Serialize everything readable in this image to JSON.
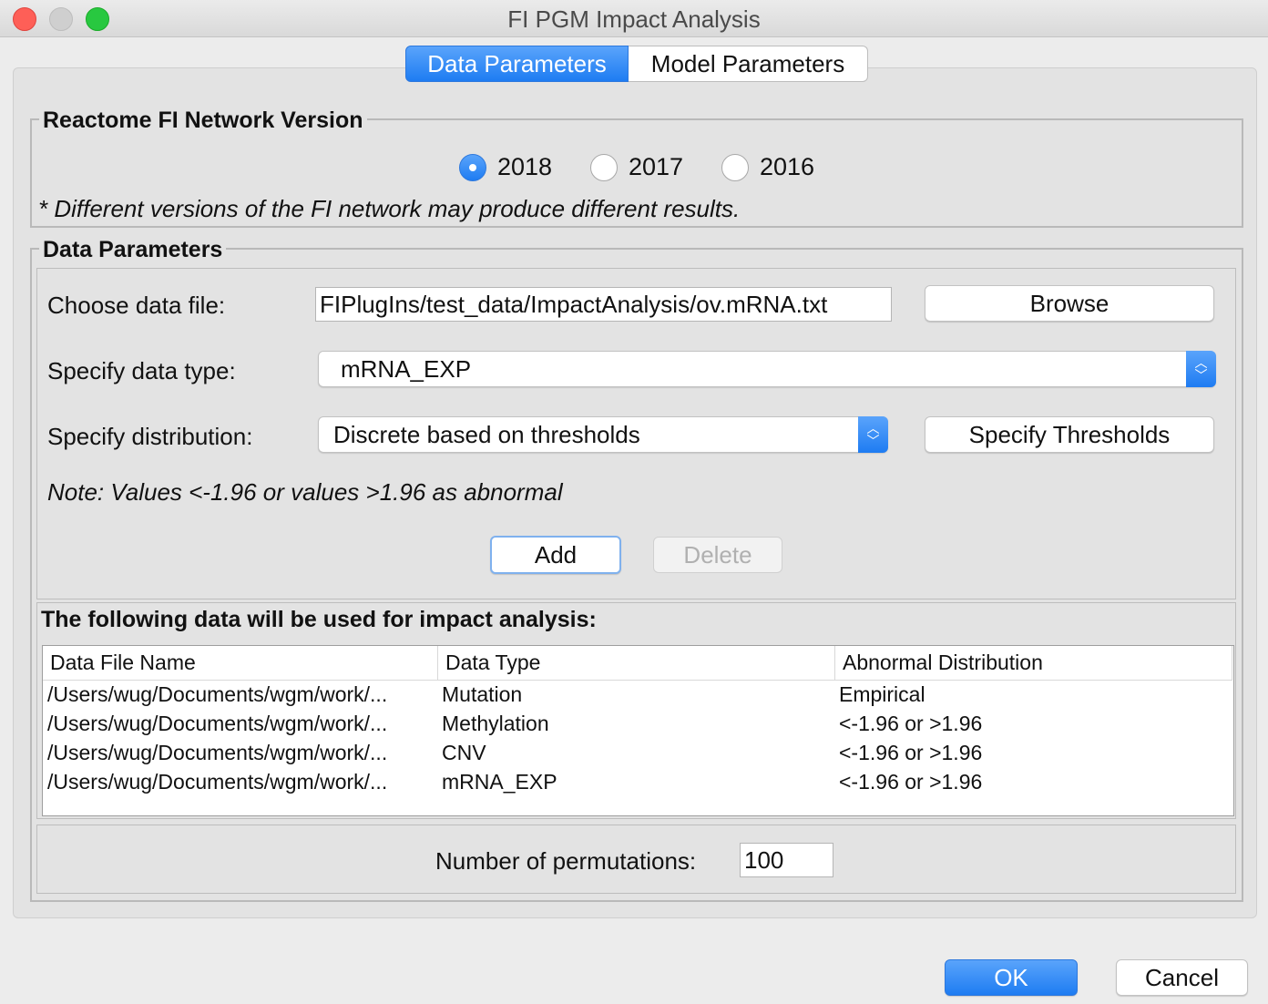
{
  "window": {
    "title": "FI PGM Impact Analysis"
  },
  "tabs": [
    {
      "label": "Data Parameters",
      "active": true
    },
    {
      "label": "Model Parameters",
      "active": false
    }
  ],
  "fi_version": {
    "legend": "Reactome FI Network Version",
    "options": [
      {
        "label": "2018",
        "selected": true
      },
      {
        "label": "2017",
        "selected": false
      },
      {
        "label": "2016",
        "selected": false
      }
    ],
    "note": "* Different versions of the FI network may produce different results."
  },
  "data_params": {
    "legend": "Data Parameters",
    "file_label": "Choose data file:",
    "file_value": "FIPlugIns/test_data/ImpactAnalysis/ov.mRNA.txt",
    "browse_label": "Browse",
    "type_label": "Specify data type:",
    "type_value": "mRNA_EXP",
    "dist_label": "Specify distribution:",
    "dist_value": "Discrete based on thresholds",
    "thresholds_label": "Specify Thresholds",
    "note": "Note: Values <-1.96 or values >1.96 as abnormal",
    "add_label": "Add",
    "delete_label": "Delete"
  },
  "data_table": {
    "heading": "The following data will be used for impact analysis:",
    "columns": [
      "Data File Name",
      "Data Type",
      "Abnormal Distribution"
    ],
    "rows": [
      [
        "/Users/wug/Documents/wgm/work/...",
        "Mutation",
        "Empirical"
      ],
      [
        "/Users/wug/Documents/wgm/work/...",
        "Methylation",
        "<-1.96 or >1.96"
      ],
      [
        "/Users/wug/Documents/wgm/work/...",
        "CNV",
        "<-1.96 or >1.96"
      ],
      [
        "/Users/wug/Documents/wgm/work/...",
        "mRNA_EXP",
        "<-1.96 or >1.96"
      ]
    ]
  },
  "permutations": {
    "label": "Number of permutations:",
    "value": "100"
  },
  "footer": {
    "ok_label": "OK",
    "cancel_label": "Cancel"
  },
  "colors": {
    "accent": "#1e7cf2",
    "window_bg": "#ececec"
  }
}
